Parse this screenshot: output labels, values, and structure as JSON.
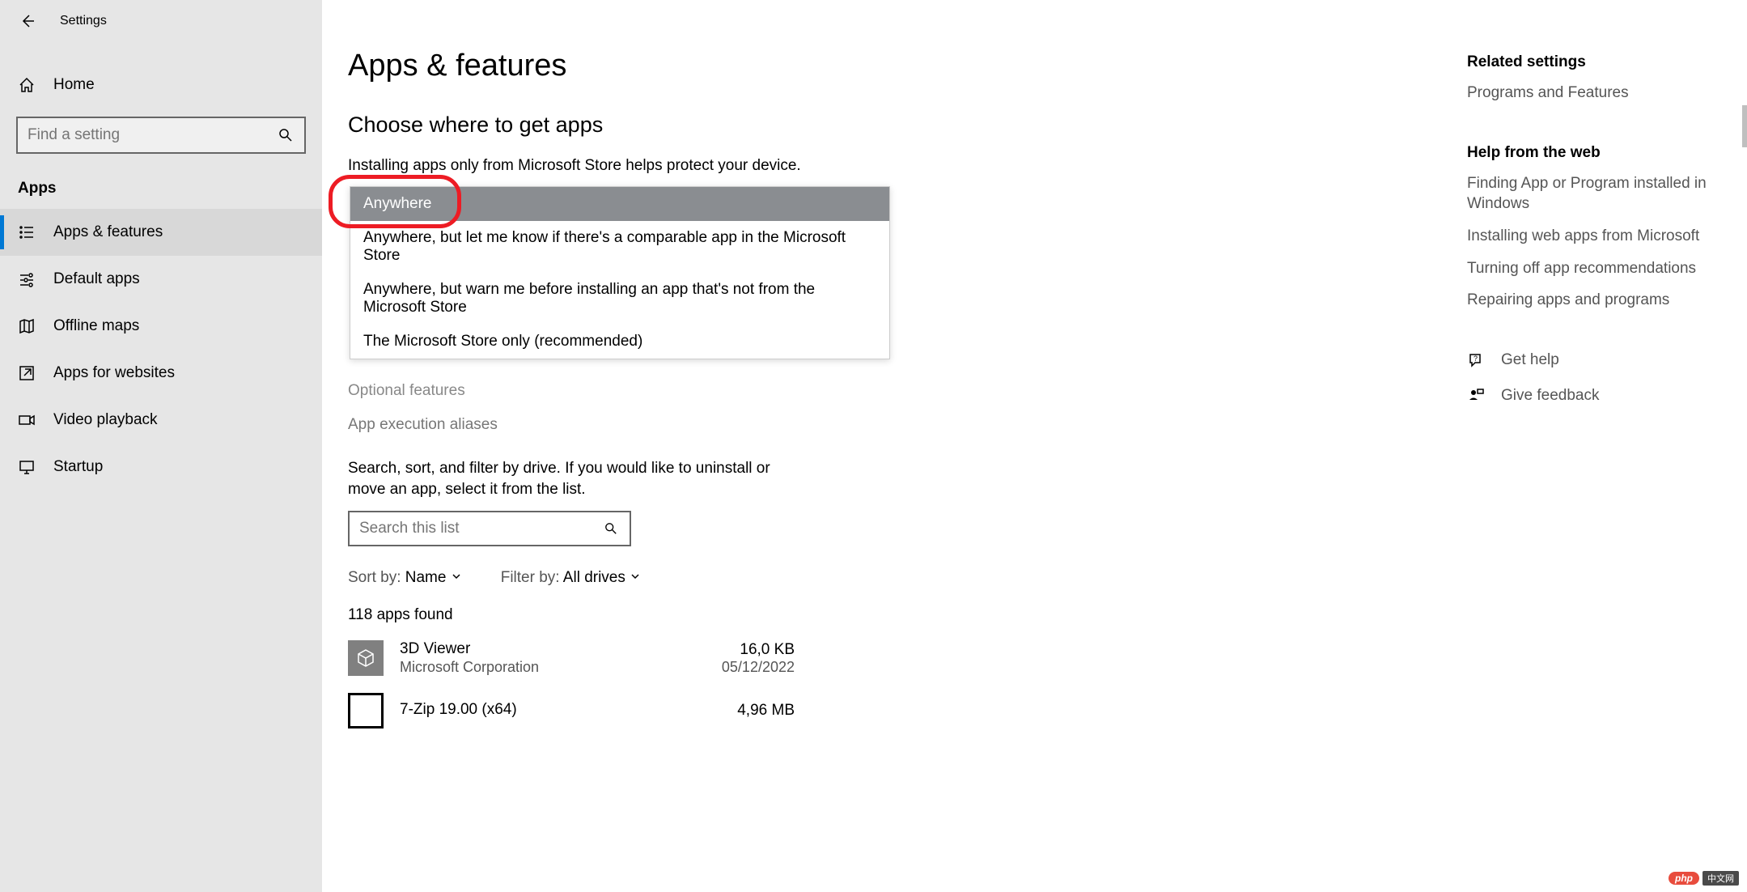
{
  "window": {
    "title": "Settings"
  },
  "sidebar": {
    "home": "Home",
    "search_placeholder": "Find a setting",
    "section": "Apps",
    "items": [
      {
        "label": "Apps & features"
      },
      {
        "label": "Default apps"
      },
      {
        "label": "Offline maps"
      },
      {
        "label": "Apps for websites"
      },
      {
        "label": "Video playback"
      },
      {
        "label": "Startup"
      }
    ]
  },
  "main": {
    "title": "Apps & features",
    "choose_heading": "Choose where to get apps",
    "choose_desc": "Installing apps only from Microsoft Store helps protect your device.",
    "dropdown": {
      "options": [
        "Anywhere",
        "Anywhere, but let me know if there's a comparable app in the Microsoft Store",
        "Anywhere, but warn me before installing an app that's not from the Microsoft Store",
        "The Microsoft Store only (recommended)"
      ]
    },
    "optional_features": "Optional features",
    "aliases": "App execution aliases",
    "search_desc": "Search, sort, and filter by drive. If you would like to uninstall or move an app, select it from the list.",
    "list_search_placeholder": "Search this list",
    "sort_label": "Sort by: ",
    "sort_value": "Name",
    "filter_label": "Filter by: ",
    "filter_value": "All drives",
    "count": "118 apps found",
    "apps": [
      {
        "name": "3D Viewer",
        "publisher": "Microsoft Corporation",
        "size": "16,0 KB",
        "date": "05/12/2022"
      },
      {
        "name": "7-Zip 19.00 (x64)",
        "publisher": "",
        "size": "4,96 MB",
        "date": ""
      }
    ]
  },
  "right": {
    "related_heading": "Related settings",
    "related_link": "Programs and Features",
    "help_heading": "Help from the web",
    "help_links": [
      "Finding App or Program installed in Windows",
      "Installing web apps from Microsoft",
      "Turning off app recommendations",
      "Repairing apps and programs"
    ],
    "get_help": "Get help",
    "feedback": "Give feedback"
  },
  "watermark": {
    "badge": "php",
    "text": "中文网"
  }
}
